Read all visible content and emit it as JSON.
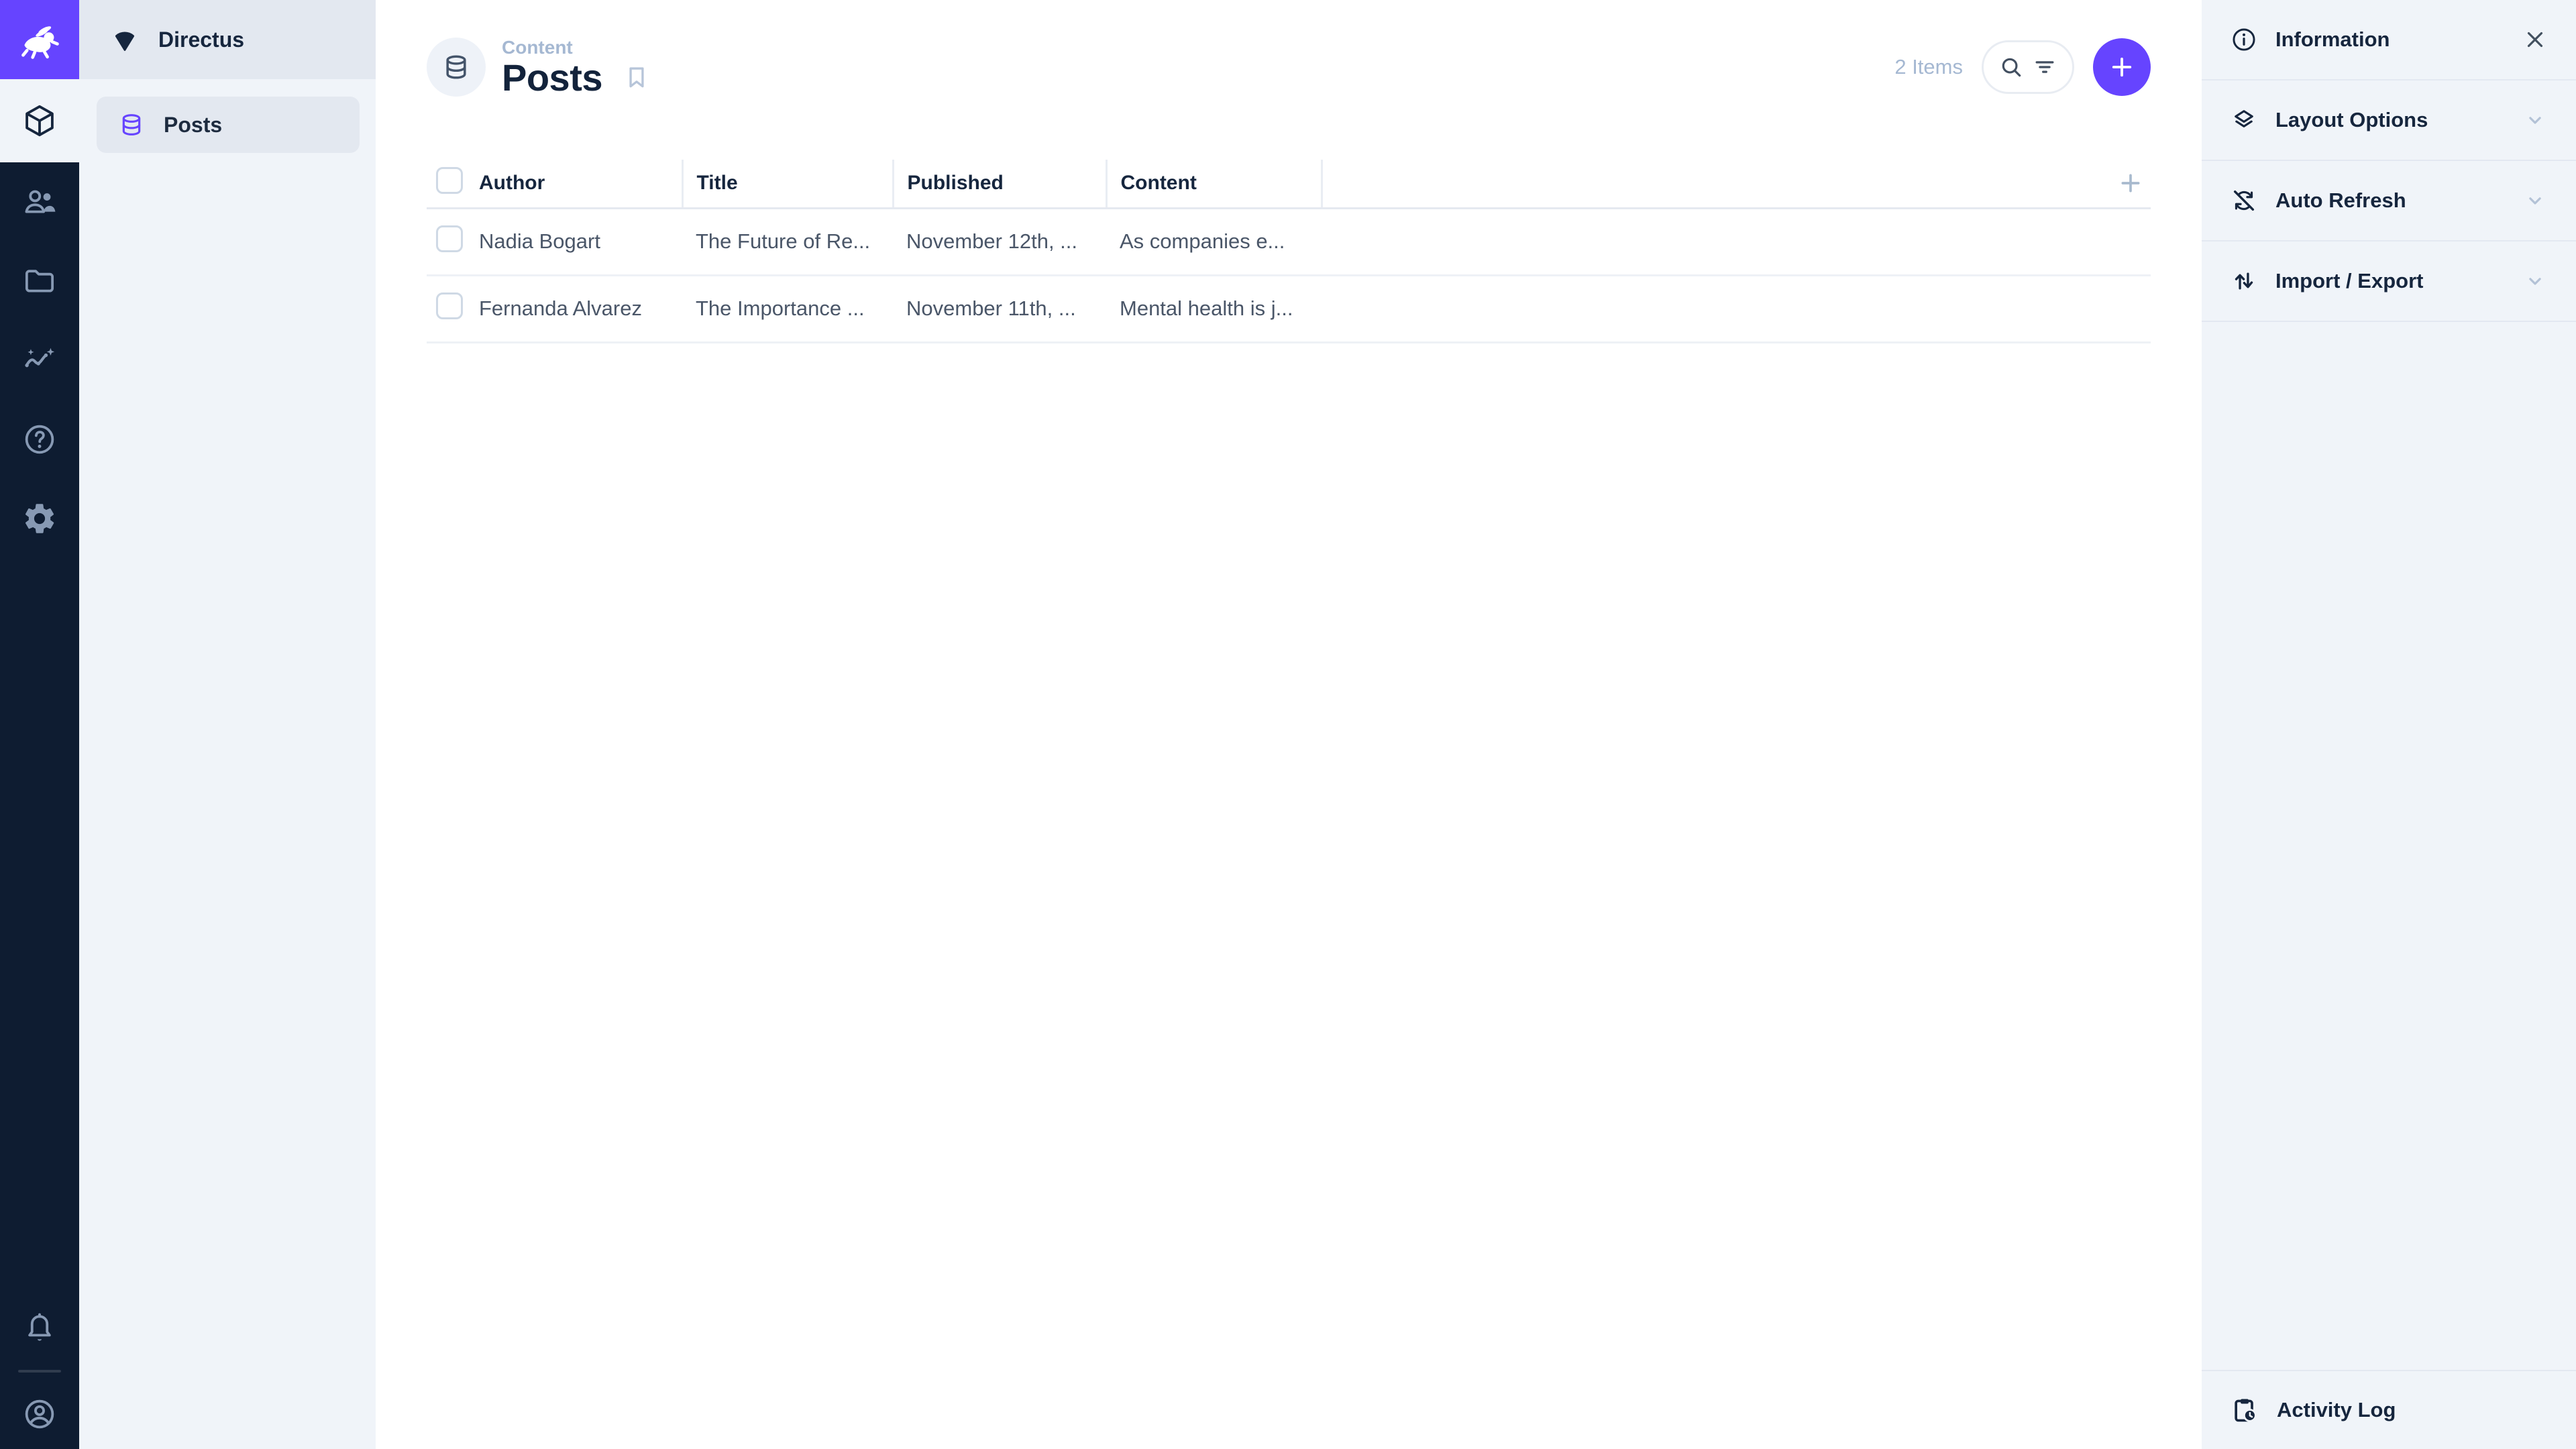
{
  "app": {
    "accent_color": "#6644ff",
    "module_bar_color": "#0e1c31",
    "icons": {
      "logo": "directus-rabbit-logo",
      "modules": [
        "content-module-cube",
        "users-module-people",
        "files-module-folder",
        "insights-module-chart",
        "docs-module-help",
        "settings-module-gear"
      ],
      "module_bottom": [
        "notifications-bell",
        "account-circle"
      ]
    }
  },
  "nav": {
    "project_name": "Directus",
    "items": [
      {
        "label": "Posts",
        "active": true,
        "icon": "database-icon"
      }
    ]
  },
  "header": {
    "breadcrumb": "Content",
    "title": "Posts",
    "collection_icon": "database-icon",
    "bookmark_icon": "bookmark-icon",
    "items_count": "2 Items",
    "search_icon": "search-icon",
    "filter_icon": "filter-icon",
    "add_button_icon": "plus-icon"
  },
  "table": {
    "columns": [
      "Author",
      "Title",
      "Published",
      "Content"
    ],
    "rows": [
      [
        "Nadia Bogart",
        "The Future of Re...",
        "November 12th, ...",
        "As companies e..."
      ],
      [
        "Fernanda Alvarez",
        "The Importance ...",
        "November 11th, ...",
        "Mental health is j..."
      ]
    ],
    "add_column_icon": "plus-icon"
  },
  "sidebar": {
    "sections": [
      {
        "label": "Information",
        "icon": "info-icon",
        "control": "close-icon"
      },
      {
        "label": "Layout Options",
        "icon": "layers-icon",
        "control": "chevron-down-icon"
      },
      {
        "label": "Auto Refresh",
        "icon": "sync-disabled-icon",
        "control": "chevron-down-icon"
      },
      {
        "label": "Import / Export",
        "icon": "import-export-icon",
        "control": "chevron-down-icon"
      }
    ],
    "footer": {
      "label": "Activity Log",
      "icon": "activity-log-icon"
    }
  }
}
